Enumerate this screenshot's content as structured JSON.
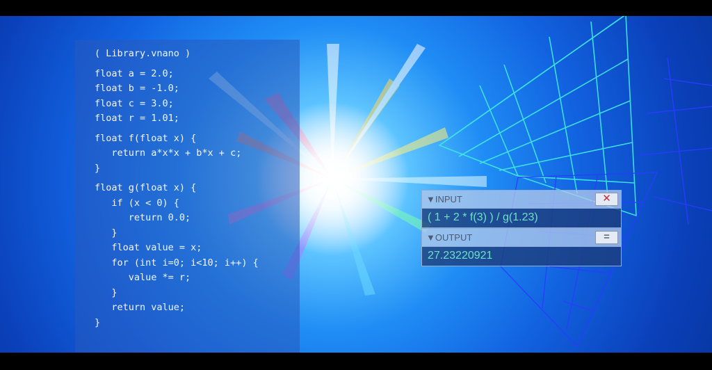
{
  "code_panel": {
    "lines": [
      "( Library.vnano )",
      "float a = 2.0;",
      "float b = -1.0;",
      "float c = 3.0;",
      "float r = 1.01;",
      "float f(float x) {",
      "   return a*x*x + b*x + c;",
      "}",
      "float g(float x) {",
      "   if (x < 0) {",
      "      return 0.0;",
      "   }",
      "   float value = x;",
      "   for (int i=0; i<10; i++) {",
      "      value *= r;",
      "   }",
      "   return value;",
      "}"
    ]
  },
  "calculator": {
    "input_label": "▼INPUT",
    "close_label": "✕",
    "input_value": "( 1 + 2 * f(3) ) / g(1.23)",
    "output_label": "▼OUTPUT",
    "equals_label": "=",
    "output_value": "27.23220921"
  },
  "icons": {
    "close": "close-icon",
    "equals": "equals-icon"
  },
  "colors": {
    "background_blue": "#1262e0",
    "glow_center": "#ffffff",
    "grid_line": "#3fe6e0",
    "output_text": "#6fe0c8",
    "close_x": "#d0283a"
  }
}
